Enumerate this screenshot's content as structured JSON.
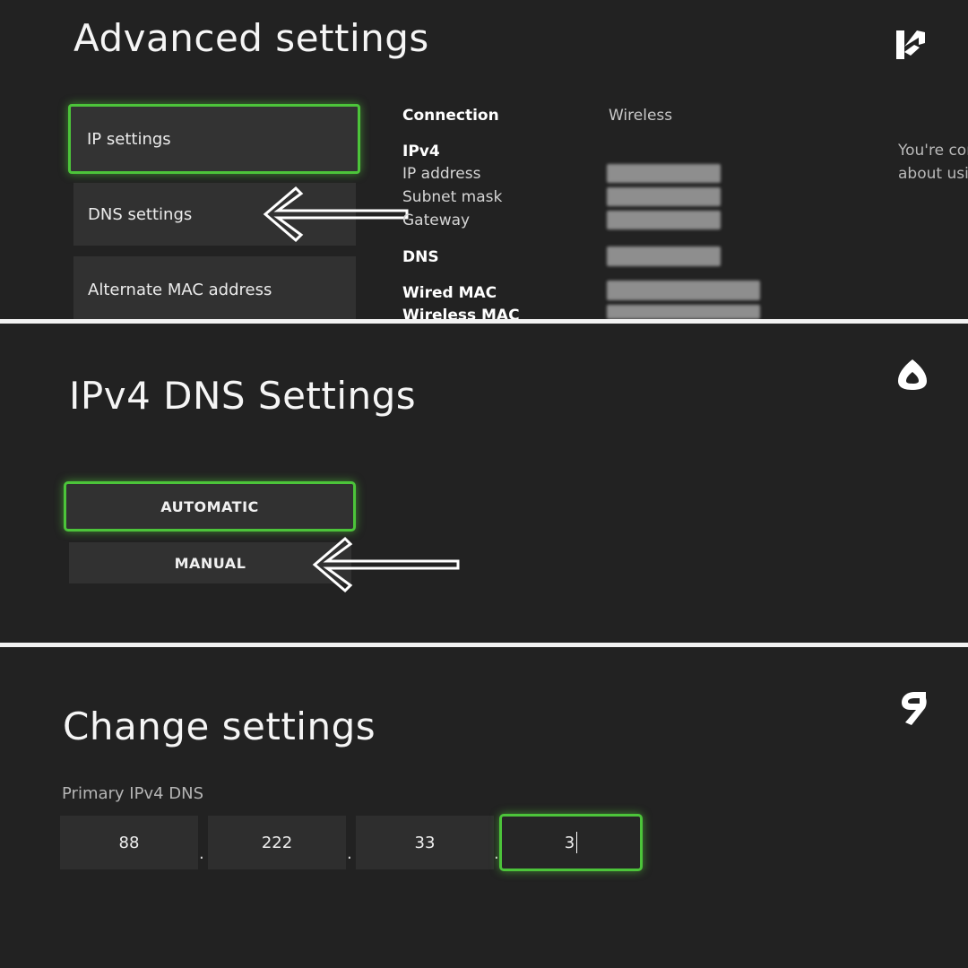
{
  "colors": {
    "background": "#222222",
    "focus": "#4cc43a",
    "button": "#313131"
  },
  "panel1": {
    "title": "Advanced settings",
    "step_badge": "۴",
    "menu": [
      "IP settings",
      "DNS settings",
      "Alternate MAC address"
    ],
    "info": {
      "connection_label": "Connection",
      "connection_value": "Wireless",
      "ipv4_label": "IPv4",
      "ip_address_label": "IP address",
      "subnet_mask_label": "Subnet mask",
      "gateway_label": "Gateway",
      "dns_label": "DNS",
      "wired_mac_label": "Wired MAC",
      "wireless_mac_label": "Wireless MAC"
    },
    "side_line1": "You're cor",
    "side_line2": "about usi",
    "arrow_icon": "left-arrow-icon"
  },
  "panel2": {
    "title": "IPv4 DNS Settings",
    "step_badge": "۵",
    "options": [
      "AUTOMATIC",
      "MANUAL"
    ],
    "arrow_icon": "left-arrow-icon"
  },
  "panel3": {
    "title": "Change settings",
    "step_badge": "۶",
    "field_label": "Primary IPv4 DNS",
    "octets": [
      "88",
      "222",
      "33",
      "3"
    ],
    "separator": "."
  }
}
